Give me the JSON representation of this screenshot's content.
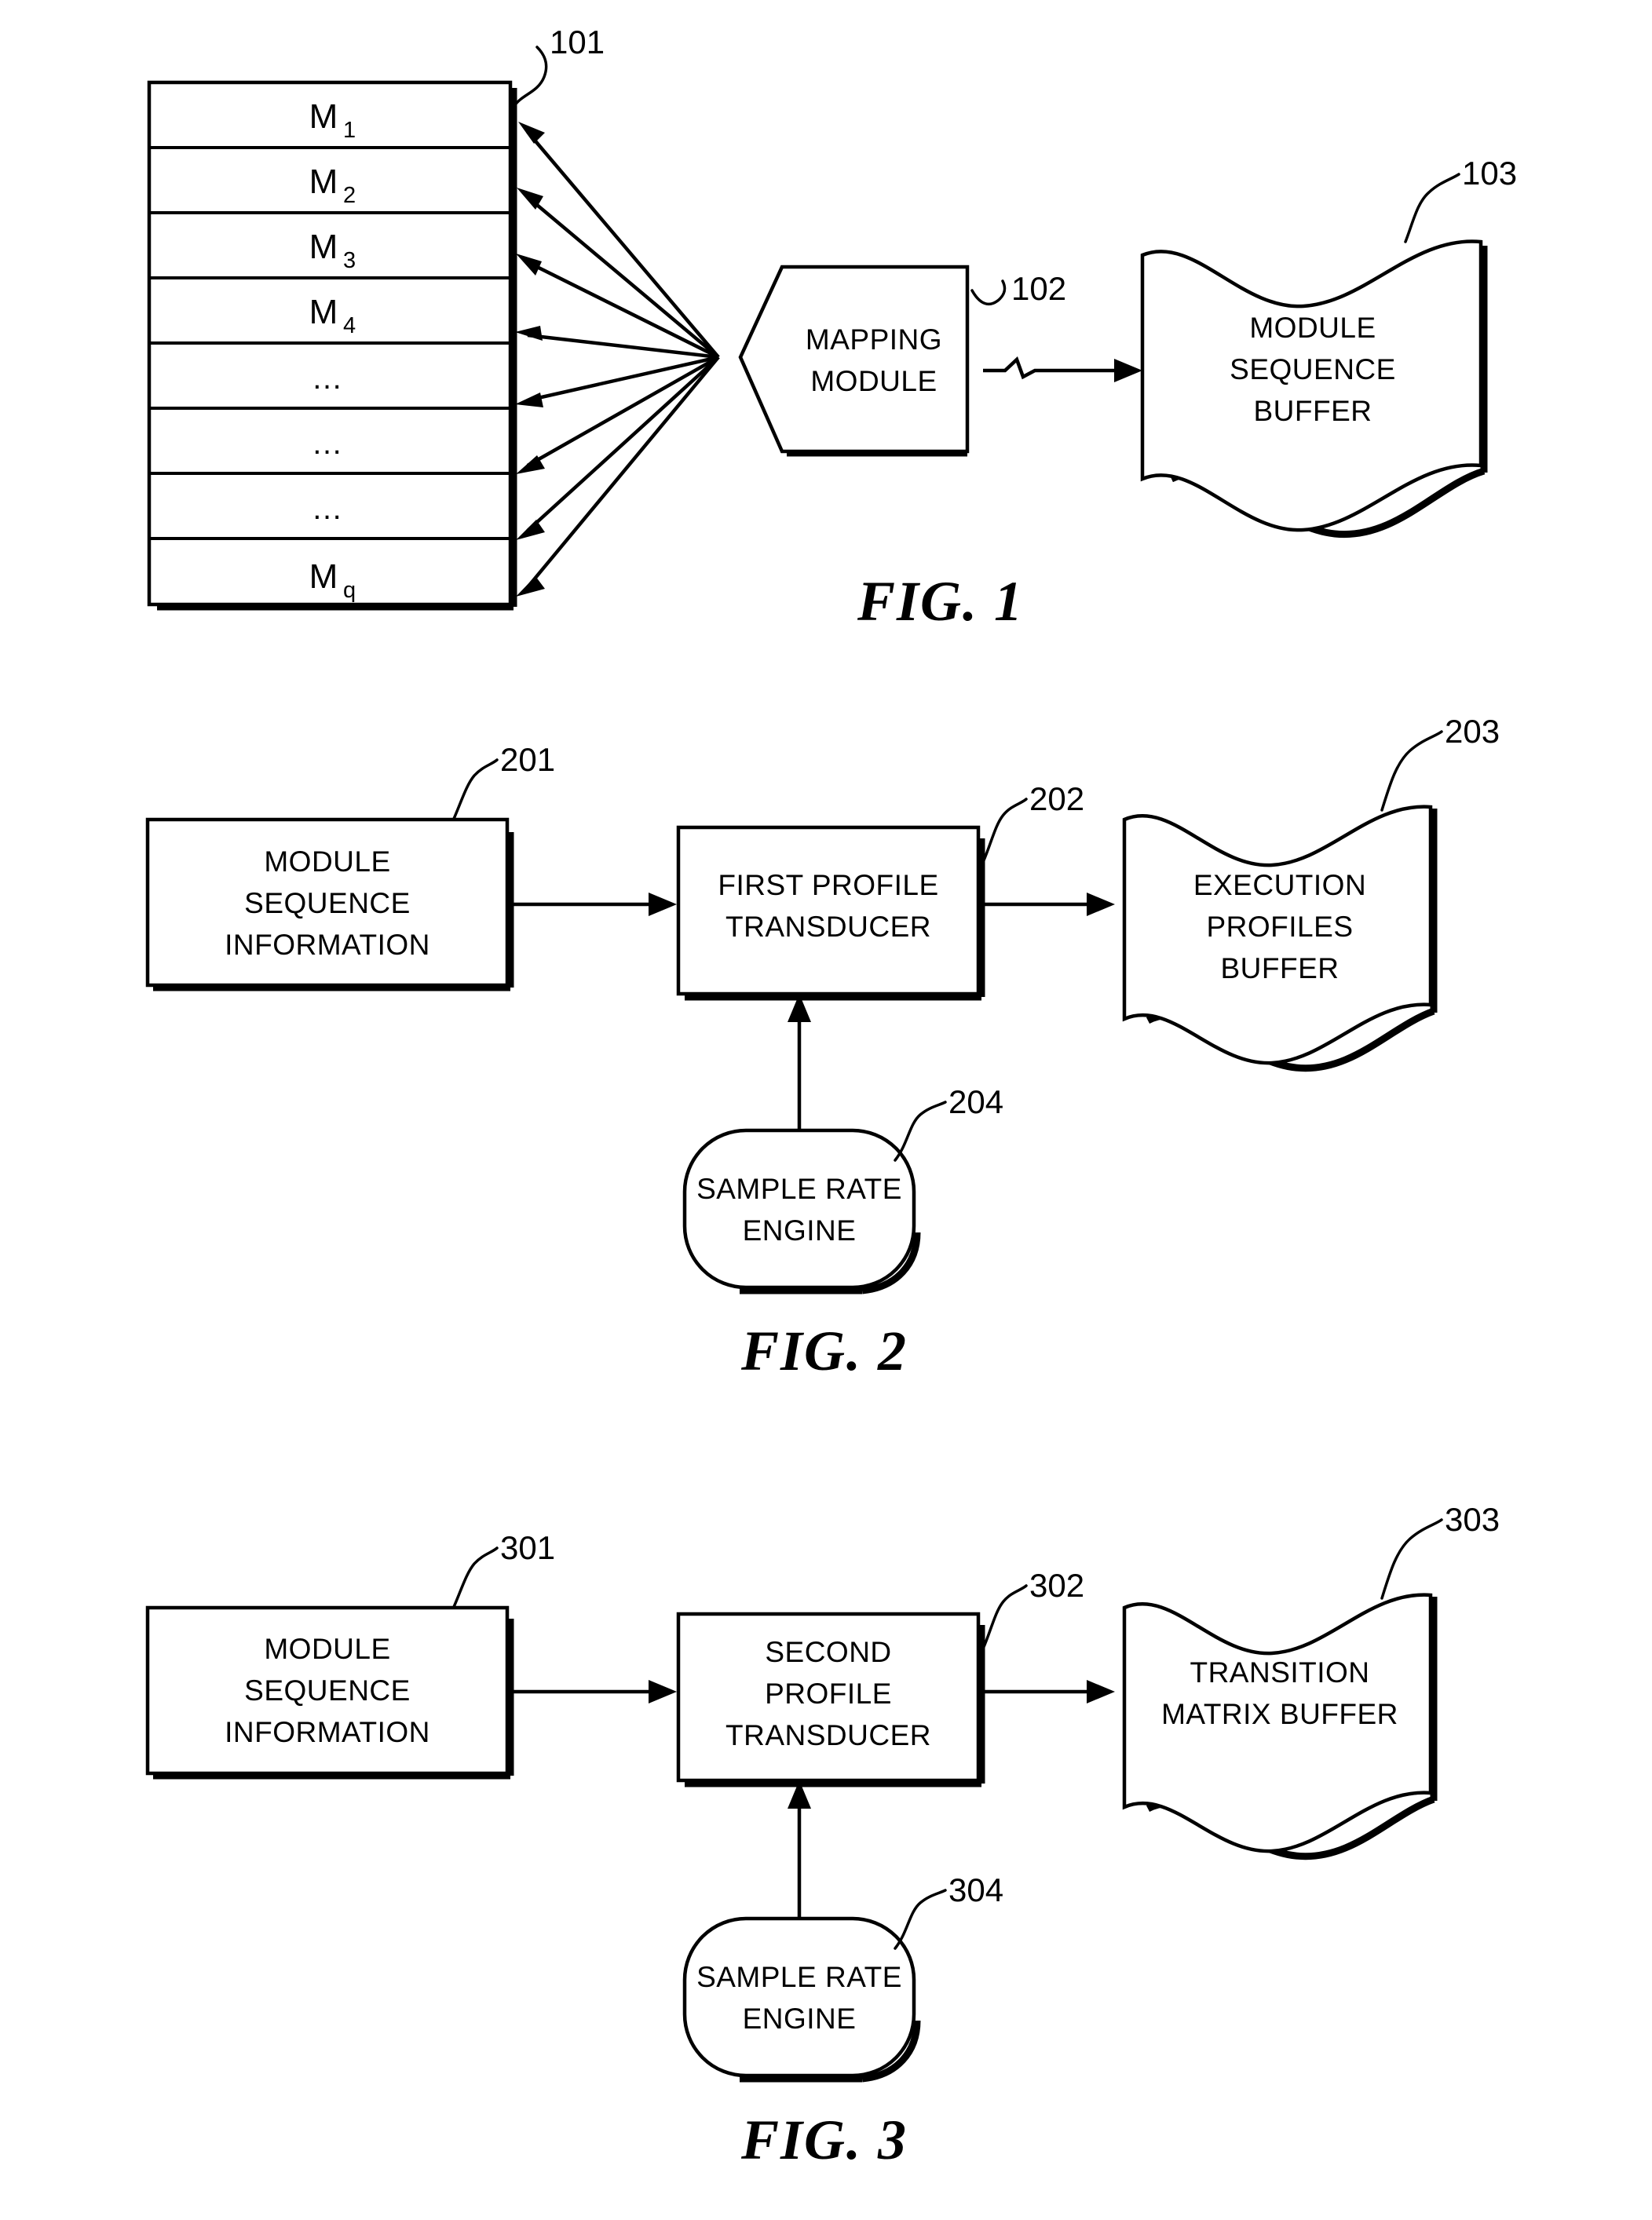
{
  "document": {
    "type": "patent-drawing-sheet",
    "figure_count": 3
  },
  "figures": [
    {
      "caption": "FIG. 1",
      "nodes": {
        "module_stack": {
          "ref": "101",
          "rows": [
            "M",
            "M",
            "M",
            "M",
            "…",
            "…",
            "…",
            "M"
          ],
          "row_labels": [
            {
              "base": "M",
              "sub": "1"
            },
            {
              "base": "M",
              "sub": "2"
            },
            {
              "base": "M",
              "sub": "3"
            },
            {
              "base": "M",
              "sub": "4"
            },
            {
              "base": "…",
              "sub": ""
            },
            {
              "base": "…",
              "sub": ""
            },
            {
              "base": "…",
              "sub": ""
            },
            {
              "base": "M",
              "sub": "q"
            }
          ]
        },
        "mapping_module": {
          "ref": "102",
          "lines": [
            "MAPPING",
            "MODULE"
          ]
        },
        "module_sequence_buffer": {
          "ref": "103",
          "lines": [
            "MODULE",
            "SEQUENCE",
            "BUFFER"
          ]
        }
      }
    },
    {
      "caption": "FIG. 2",
      "nodes": {
        "module_sequence_information": {
          "ref": "201",
          "lines": [
            "MODULE",
            "SEQUENCE",
            "INFORMATION"
          ]
        },
        "first_profile_transducer": {
          "ref": "202",
          "lines": [
            "FIRST PROFILE",
            "TRANSDUCER"
          ]
        },
        "execution_profiles_buffer": {
          "ref": "203",
          "lines": [
            "EXECUTION",
            "PROFILES",
            "BUFFER"
          ]
        },
        "sample_rate_engine": {
          "ref": "204",
          "lines": [
            "SAMPLE RATE",
            "ENGINE"
          ]
        }
      }
    },
    {
      "caption": "FIG. 3",
      "nodes": {
        "module_sequence_information": {
          "ref": "301",
          "lines": [
            "MODULE",
            "SEQUENCE",
            "INFORMATION"
          ]
        },
        "second_profile_transducer": {
          "ref": "302",
          "lines": [
            "SECOND",
            "PROFILE",
            "TRANSDUCER"
          ]
        },
        "transition_matrix_buffer": {
          "ref": "303",
          "lines": [
            "TRANSITION",
            "MATRIX BUFFER"
          ]
        },
        "sample_rate_engine": {
          "ref": "304",
          "lines": [
            "SAMPLE RATE",
            "ENGINE"
          ]
        }
      }
    }
  ],
  "colors": {
    "ink": "#000000",
    "paper": "#ffffff"
  }
}
